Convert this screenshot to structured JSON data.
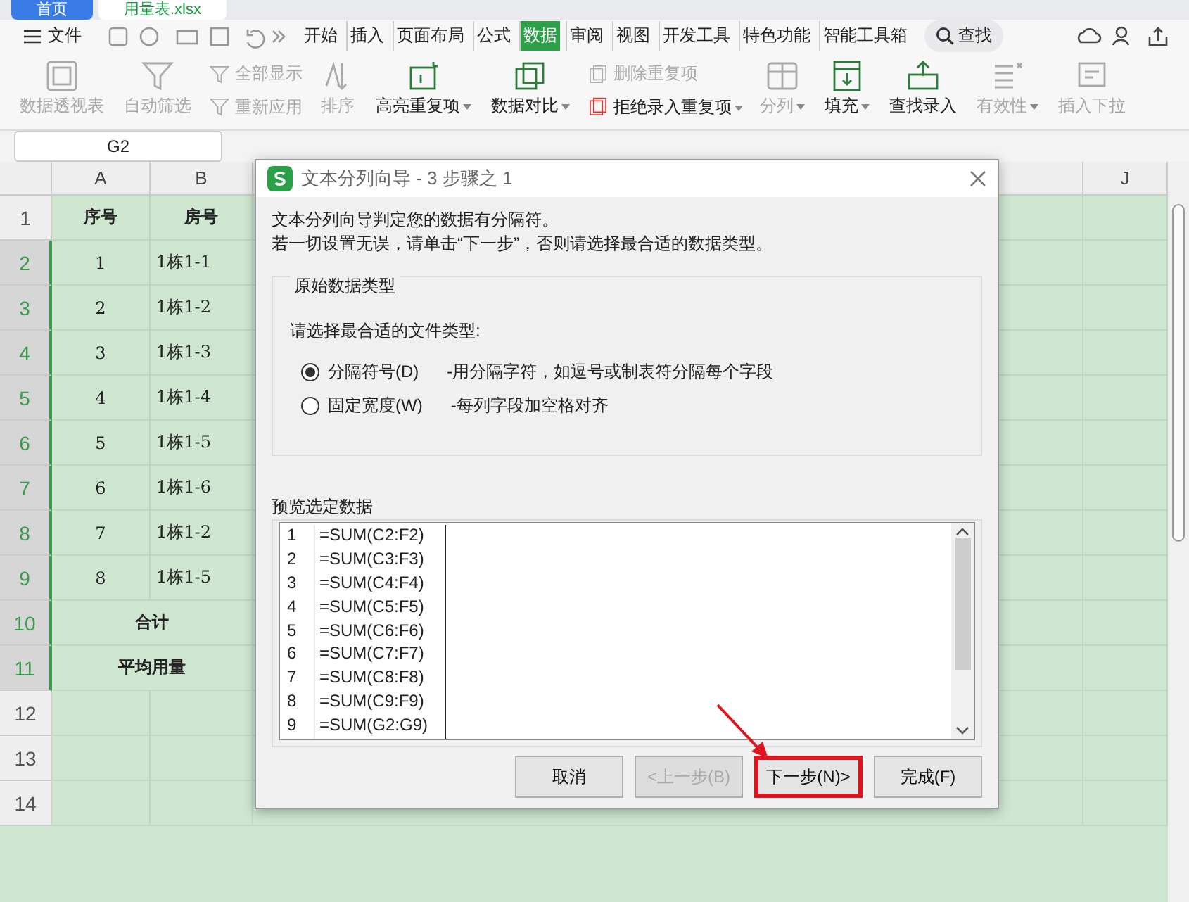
{
  "file_tabs": [
    {
      "label": "首页",
      "selected": false
    },
    {
      "label": "用量表.xlsx",
      "selected": true
    }
  ],
  "menu": {
    "file": "文件",
    "tabs": [
      {
        "label": "开始",
        "selected": false
      },
      {
        "label": "插入",
        "selected": false
      },
      {
        "label": "页面布局",
        "selected": false
      },
      {
        "label": "公式",
        "selected": false
      },
      {
        "label": "数据",
        "selected": true
      },
      {
        "label": "审阅",
        "selected": false
      },
      {
        "label": "视图",
        "selected": false
      },
      {
        "label": "开发工具",
        "selected": false
      },
      {
        "label": "特色功能",
        "selected": false
      },
      {
        "label": "智能工具箱",
        "selected": false
      }
    ],
    "search": "查找"
  },
  "ribbon": [
    {
      "kind": "large",
      "label": "数据透视表",
      "disabled": true,
      "dropdown": false
    },
    {
      "kind": "large",
      "label": "自动筛选",
      "disabled": true,
      "dropdown": false
    },
    {
      "kind": "stack",
      "items": [
        {
          "label": "全部显示",
          "disabled": true,
          "dropdown": false
        },
        {
          "label": "重新应用",
          "disabled": true,
          "dropdown": false
        }
      ]
    },
    {
      "kind": "large",
      "label": "排序",
      "disabled": true,
      "dropdown": false
    },
    {
      "kind": "large",
      "label": "高亮重复项",
      "disabled": false,
      "dropdown": true
    },
    {
      "kind": "large",
      "label": "数据对比",
      "disabled": false,
      "dropdown": true
    },
    {
      "kind": "stack",
      "items": [
        {
          "label": "删除重复项",
          "disabled": true,
          "dropdown": false
        },
        {
          "label": "拒绝录入重复项",
          "disabled": false,
          "dropdown": true
        }
      ]
    },
    {
      "kind": "large",
      "label": "分列",
      "disabled": true,
      "dropdown": true
    },
    {
      "kind": "large",
      "label": "填充",
      "disabled": false,
      "dropdown": true
    },
    {
      "kind": "large",
      "label": "查找录入",
      "disabled": false,
      "dropdown": false
    },
    {
      "kind": "large",
      "label": "有效性",
      "disabled": true,
      "dropdown": true
    },
    {
      "kind": "large",
      "label": "插入下拉",
      "disabled": true,
      "dropdown": false
    }
  ],
  "sheet": {
    "name_box": "G2",
    "columns": [
      {
        "label": "A",
        "selected": false
      },
      {
        "label": "B",
        "selected": false
      },
      {
        "label": "J",
        "selected": false
      }
    ],
    "rows": [
      {
        "number": "1",
        "selected": false,
        "kind": "pair",
        "cells": [
          "序号",
          "房号"
        ],
        "bold": true
      },
      {
        "number": "2",
        "selected": true,
        "kind": "pair",
        "cells": [
          "1",
          "1栋1-1"
        ]
      },
      {
        "number": "3",
        "selected": true,
        "kind": "pair",
        "cells": [
          "2",
          "1栋1-2"
        ]
      },
      {
        "number": "4",
        "selected": true,
        "kind": "pair",
        "cells": [
          "3",
          "1栋1-3"
        ]
      },
      {
        "number": "5",
        "selected": true,
        "kind": "pair",
        "cells": [
          "4",
          "1栋1-4"
        ]
      },
      {
        "number": "6",
        "selected": true,
        "kind": "pair",
        "cells": [
          "5",
          "1栋1-5"
        ]
      },
      {
        "number": "7",
        "selected": true,
        "kind": "pair",
        "cells": [
          "6",
          "1栋1-6"
        ]
      },
      {
        "number": "8",
        "selected": true,
        "kind": "pair",
        "cells": [
          "7",
          "1栋1-2"
        ]
      },
      {
        "number": "9",
        "selected": true,
        "kind": "pair",
        "cells": [
          "8",
          "1栋1-5"
        ]
      },
      {
        "number": "10",
        "selected": true,
        "kind": "merged",
        "cells": [
          "合计"
        ],
        "bold": true
      },
      {
        "number": "11",
        "selected": true,
        "kind": "merged",
        "cells": [
          "平均用量"
        ],
        "bold": true
      },
      {
        "number": "12",
        "selected": false,
        "kind": "empty"
      },
      {
        "number": "13",
        "selected": false,
        "kind": "empty"
      },
      {
        "number": "14",
        "selected": false,
        "kind": "empty"
      }
    ]
  },
  "dialog": {
    "title": "文本分列向导 - 3 步骤之 1",
    "intro": [
      "文本分列向导判定您的数据有分隔符。",
      "若一切设置无误，请单击“下一步”，否则请选择最合适的数据类型。"
    ],
    "group_title": "原始数据类型",
    "prompt": "请选择最合适的文件类型:",
    "options": [
      {
        "label": "分隔符号(D)",
        "description": "-用分隔字符，如逗号或制表符分隔每个字段",
        "selected": true
      },
      {
        "label": "固定宽度(W)",
        "description": "-每列字段加空格对齐",
        "selected": false
      }
    ],
    "preview_title": "预览选定数据",
    "preview_rows": [
      {
        "number": "1",
        "text": "=SUM(C2:F2)"
      },
      {
        "number": "2",
        "text": "=SUM(C3:F3)"
      },
      {
        "number": "3",
        "text": "=SUM(C4:F4)"
      },
      {
        "number": "4",
        "text": "=SUM(C5:F5)"
      },
      {
        "number": "5",
        "text": "=SUM(C6:F6)"
      },
      {
        "number": "6",
        "text": "=SUM(C7:F7)"
      },
      {
        "number": "7",
        "text": "=SUM(C8:F8)"
      },
      {
        "number": "8",
        "text": "=SUM(C9:F9)"
      },
      {
        "number": "9",
        "text": "=SUM(G2:G9)"
      }
    ],
    "buttons": [
      {
        "label": "取消",
        "disabled": false,
        "highlighted": false
      },
      {
        "label": "<上一步(B)",
        "disabled": true,
        "highlighted": false
      },
      {
        "label": "下一步(N)>",
        "disabled": false,
        "highlighted": true
      },
      {
        "label": "完成(F)",
        "disabled": false,
        "highlighted": false
      }
    ]
  }
}
